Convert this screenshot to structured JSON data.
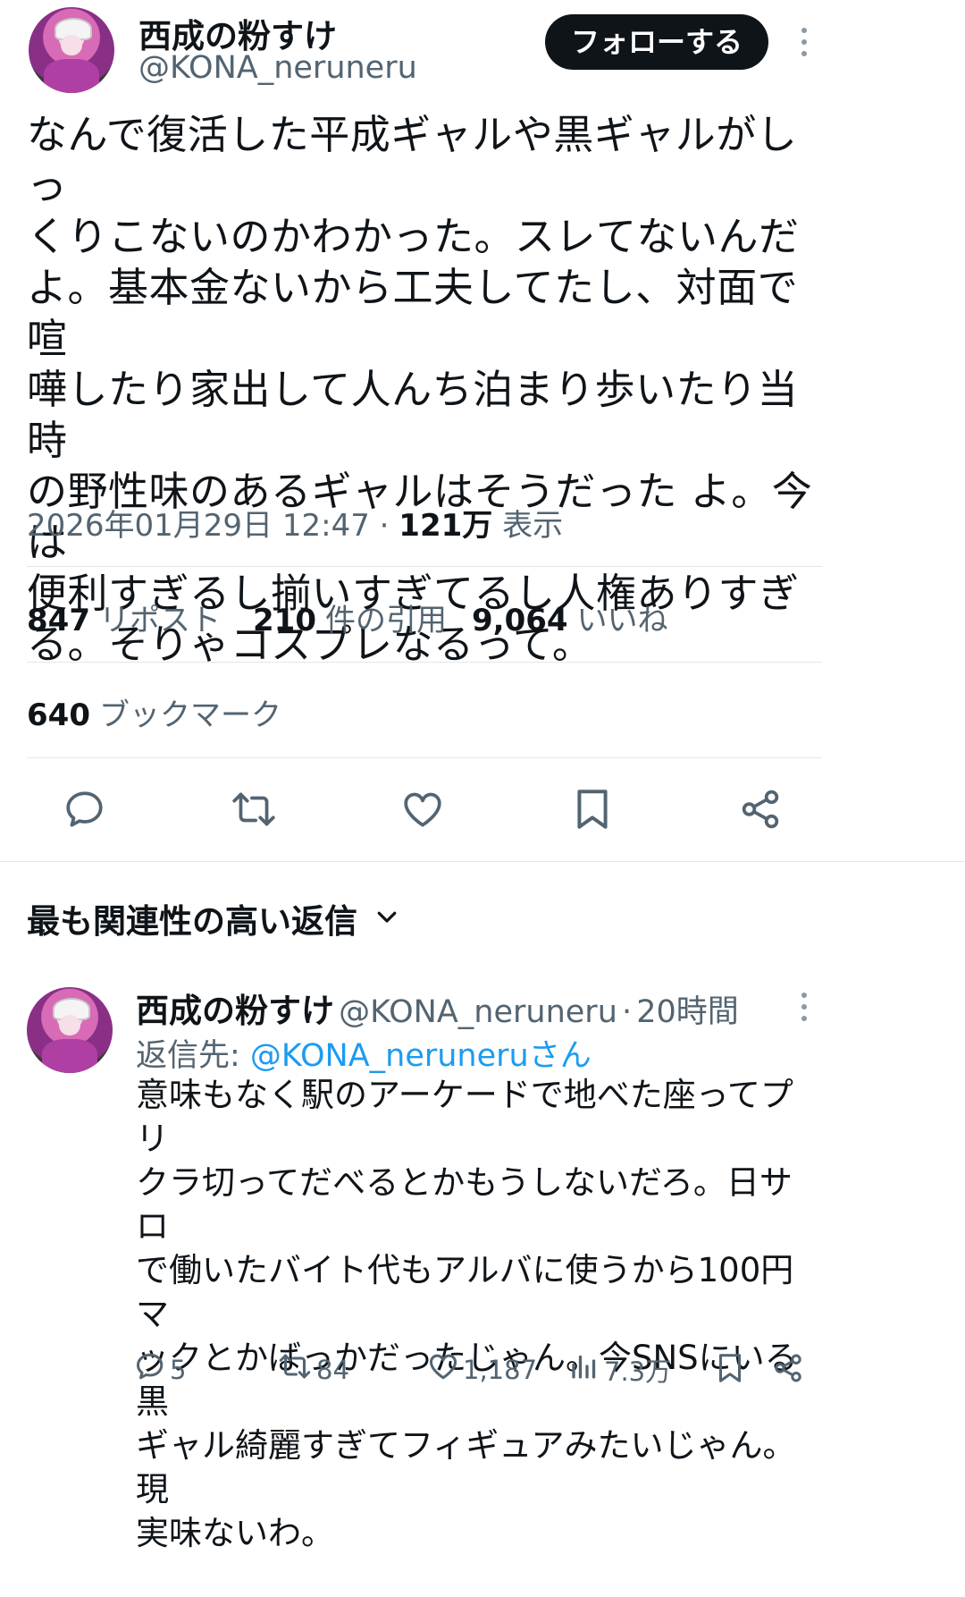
{
  "post": {
    "author_name": "西成の粉すけ",
    "author_handle": "@KONA_neruneru",
    "follow_label": "フォローする",
    "text": "なんで復活した平成ギャルや黒ギャルがしっ\nくりこないのかわかった。スレてないんだ\nよ。基本金ないから工夫してたし、対面で喧\n嘩したり家出して人んち泊まり歩いたり当時\nの野性味のあるギャルはそうだった よ。今は\n便利すぎるし揃いすぎてるし人権ありすぎ\nる。そりゃコスプレなるって。",
    "timestamp": "2026年01月29日 12:47",
    "views_count": "121万",
    "views_label": "表示",
    "stats": {
      "reposts_count": "847",
      "reposts_label": "リポスト",
      "quotes_count": "210",
      "quotes_label": "件の引用",
      "likes_count": "9,064",
      "likes_label": "いいね",
      "bookmarks_count": "640",
      "bookmarks_label": "ブックマーク"
    },
    "actions": [
      "comment-icon",
      "repost-icon",
      "heart-icon",
      "bookmark-icon",
      "share-icon"
    ]
  },
  "replies_section": {
    "title": "最も関連性の高い返信"
  },
  "reply": {
    "author_name": "西成の粉すけ",
    "author_handle": "@KONA_neruneru",
    "separator": "·",
    "time_ago": "20時間",
    "reply_to_prefix": "返信先: ",
    "reply_to_handle": "@KONA_neruneruさん",
    "text": "意味もなく駅のアーケードで地べた座ってプリ\nクラ切ってだべるとかもうしないだろ。日サロ\nで働いたバイト代もアルバに使うから100円マ\nックとかばっかだったじゃん。今SNSにいる黒\nギャル綺麗すぎてフィギュアみたいじゃん。現\n実味ないわ。",
    "replies_count": "5",
    "reposts_count": "84",
    "likes_count": "1,187",
    "views_count": "7.3万"
  },
  "colors": {
    "text": "#0f1419",
    "secondary": "#536471",
    "accent": "#1d9bf0",
    "divider": "#e3e6e9"
  }
}
